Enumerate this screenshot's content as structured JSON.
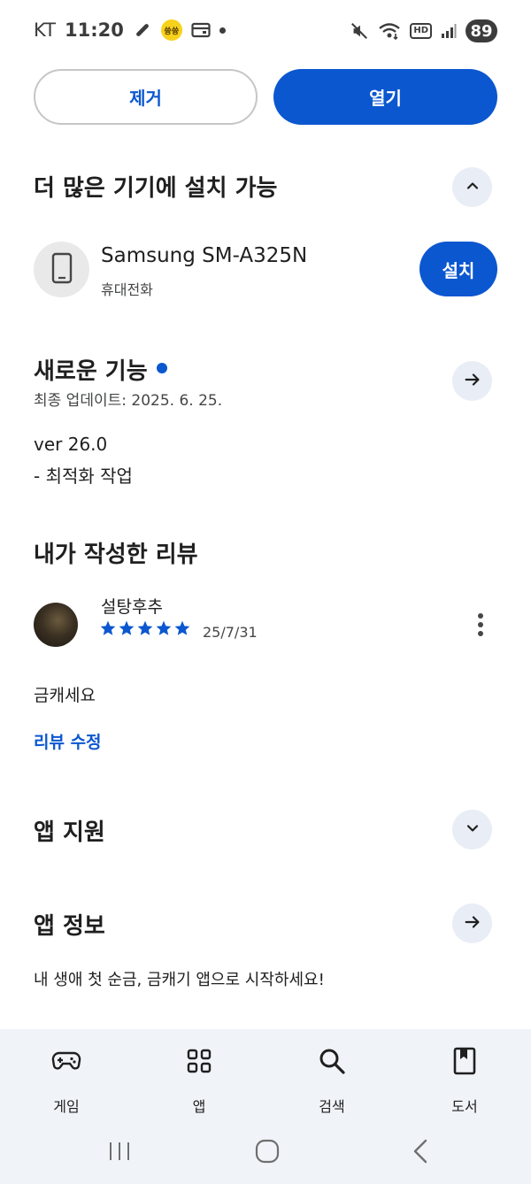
{
  "status_bar": {
    "carrier": "KT",
    "time": "11:20",
    "badge_text": "쓩쓩",
    "hd": "HD",
    "battery": "89"
  },
  "actions": {
    "remove_label": "제거",
    "open_label": "열기"
  },
  "more_devices": {
    "title": "더 많은 기기에 설치 가능",
    "device_name": "Samsung SM-A325N",
    "device_type": "휴대전화",
    "install_label": "설치"
  },
  "whats_new": {
    "title": "새로운 기능",
    "updated": "최종 업데이트: 2025. 6. 25.",
    "version": "ver 26.0",
    "change": "- 최적화 작업"
  },
  "my_review": {
    "title": "내가 작성한 리뷰",
    "reviewer": "설탕후추",
    "rating": 5,
    "date": "25/7/31",
    "text": "금캐세요",
    "edit_label": "리뷰 수정"
  },
  "app_support": {
    "title": "앱 지원"
  },
  "app_info": {
    "title": "앱 정보",
    "description": "내 생애 첫 순금, 금캐기 앱으로 시작하세요!"
  },
  "bottom_nav": {
    "items": [
      {
        "label": "게임",
        "icon": "gamepad-icon"
      },
      {
        "label": "앱",
        "icon": "apps-grid-icon"
      },
      {
        "label": "검색",
        "icon": "search-icon"
      },
      {
        "label": "도서",
        "icon": "book-icon"
      }
    ]
  },
  "colors": {
    "accent": "#0b57d0",
    "chip_bg": "#e9eef6",
    "nav_bg": "#f0f4f9"
  }
}
